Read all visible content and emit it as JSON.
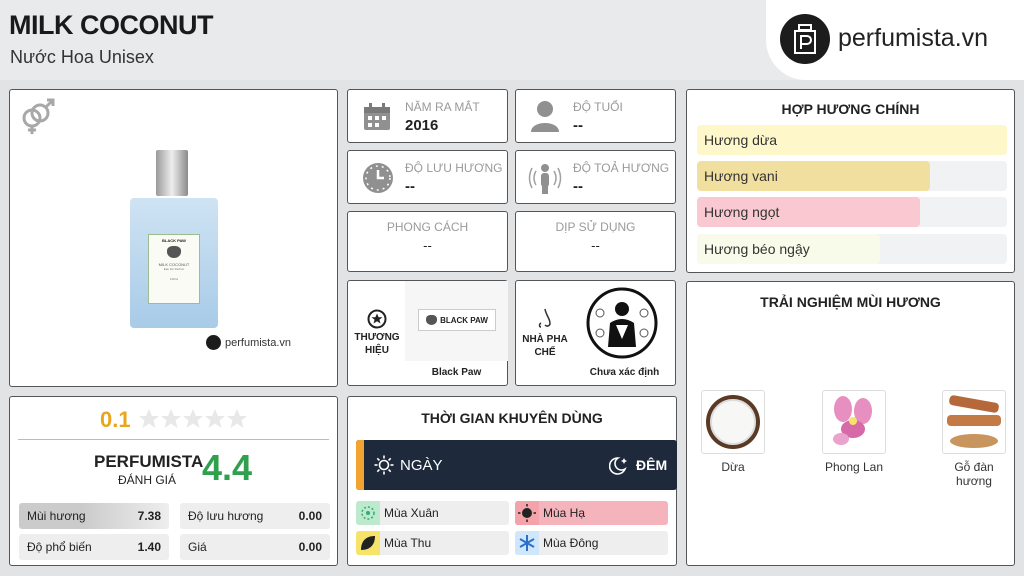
{
  "product": {
    "name": "MILK COCONUT",
    "type": "Nước Hoa Unisex"
  },
  "brand_site": "perfumista.vn",
  "bottle": {
    "brand_label": "BLACK PAW",
    "name_label": "MILK COCONUT",
    "sub_label": "Eau De Parfum",
    "size_label": "100ml"
  },
  "info": {
    "release_year": {
      "label": "NĂM RA MẮT",
      "value": "2016"
    },
    "age": {
      "label": "ĐỘ TUỔI",
      "value": "--"
    },
    "longevity": {
      "label": "ĐỘ LƯU HƯƠNG",
      "value": "--"
    },
    "sillage": {
      "label": "ĐỘ TOẢ HƯƠNG",
      "value": "--"
    },
    "style": {
      "label": "PHONG CÁCH",
      "value": "--"
    },
    "occasion": {
      "label": "DỊP SỬ DỤNG",
      "value": "--"
    }
  },
  "brand": {
    "label": "THƯƠNG HIỆU",
    "logo_text": "BLACK PAW",
    "name": "Black Paw"
  },
  "perfumer": {
    "label": "NHÀ PHA CHẾ",
    "name": "Chưa xác định"
  },
  "accords": {
    "title": "HỢP HƯƠNG CHÍNH",
    "items": [
      {
        "label": "Hương dừa",
        "level": 1.0,
        "color": "#fdf7c9"
      },
      {
        "label": "Hương vani",
        "level": 0.75,
        "color": "#f1dfa0"
      },
      {
        "label": "Hương ngọt",
        "level": 0.72,
        "color": "#f9c8d0"
      },
      {
        "label": "Hương béo ngậy",
        "level": 0.59,
        "color": "#f9fbea"
      }
    ]
  },
  "rating": {
    "user_score": "0.1",
    "stars": 5,
    "perfumista_label": "PERFUMISTA",
    "rating_label": "ĐÁNH GIÁ",
    "perfumista_score": "4.4",
    "stats": [
      {
        "label": "Mùi hương",
        "value": "7.38",
        "level": 0.738
      },
      {
        "label": "Độ lưu hương",
        "value": "0.00",
        "level": 0
      },
      {
        "label": "Độ phổ biến",
        "value": "1.40",
        "level": 0.14
      },
      {
        "label": "Giá",
        "value": "0.00",
        "level": 0
      }
    ]
  },
  "usage_time": {
    "title": "THỜI GIAN KHUYÊN DÙNG",
    "day_label": "NGÀY",
    "night_label": "ĐÊM",
    "seasons": [
      {
        "label": "Mùa Xuân",
        "color": "#bdeacc",
        "bg": "#eeeeee"
      },
      {
        "label": "Mùa Hạ",
        "color": "#f5a3aa",
        "bg": "#f5b3bb"
      },
      {
        "label": "Mùa Thu",
        "color": "#f6e36a",
        "bg": "#eeeeee"
      },
      {
        "label": "Mùa Đông",
        "color": "#cfe6fb",
        "bg": "#eeeeee"
      }
    ]
  },
  "experience": {
    "title": "TRẢI NGHIỆM MÙI HƯƠNG",
    "notes": [
      {
        "label": "Dừa"
      },
      {
        "label": "Phong Lan"
      },
      {
        "label": "Gỗ đàn hương"
      }
    ]
  }
}
